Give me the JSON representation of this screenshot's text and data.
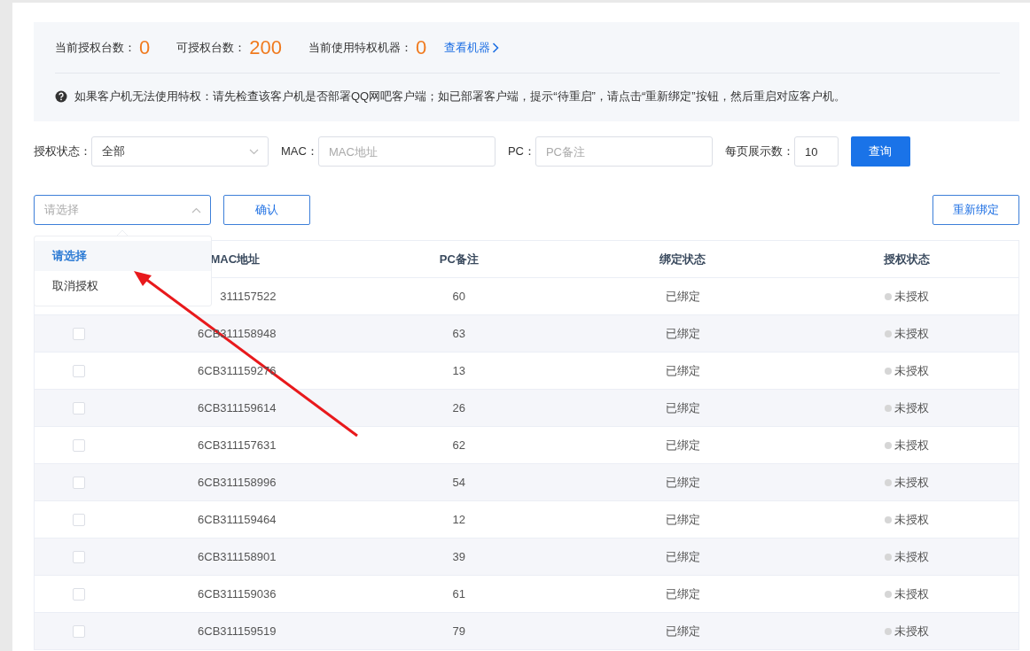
{
  "summary": {
    "stats": [
      {
        "label": "当前授权台数：",
        "value": "0"
      },
      {
        "label": "可授权台数：",
        "value": "200"
      },
      {
        "label": "当前使用特权机器：",
        "value": "0"
      }
    ],
    "link": "查看机器",
    "notice": "如果客户机无法使用特权：请先检查该客户机是否部署QQ网吧客户端；如已部署客户端，提示“待重启”，请点击“重新绑定”按钮，然后重启对应客户机。"
  },
  "filters": {
    "status_label": "授权状态：",
    "status_value": "全部",
    "mac_label": "MAC：",
    "mac_placeholder": "MAC地址",
    "pc_label": "PC：",
    "pc_placeholder": "PC备注",
    "page_size_label": "每页展示数：",
    "page_size_value": "10",
    "query_button": "查询"
  },
  "actions": {
    "select_placeholder": "请选择",
    "expanded": true,
    "options": [
      {
        "label": "请选择",
        "selected": true
      },
      {
        "label": "取消授权",
        "selected": false
      }
    ],
    "confirm_button": "确认",
    "rebind_button": "重新绑定"
  },
  "table": {
    "columns": [
      "MAC地址",
      "PC备注",
      "绑定状态",
      "授权状态"
    ],
    "rows": [
      {
        "mac": "311157522",
        "pc": "60",
        "bind": "已绑定",
        "auth": "未授权"
      },
      {
        "mac": "6CB311158948",
        "pc": "63",
        "bind": "已绑定",
        "auth": "未授权",
        "checked": false
      },
      {
        "mac": "6CB311159276",
        "pc": "13",
        "bind": "已绑定",
        "auth": "未授权",
        "checked": false
      },
      {
        "mac": "6CB311159614",
        "pc": "26",
        "bind": "已绑定",
        "auth": "未授权",
        "checked": false
      },
      {
        "mac": "6CB311157631",
        "pc": "62",
        "bind": "已绑定",
        "auth": "未授权",
        "checked": false
      },
      {
        "mac": "6CB311158996",
        "pc": "54",
        "bind": "已绑定",
        "auth": "未授权",
        "checked": false
      },
      {
        "mac": "6CB311159464",
        "pc": "12",
        "bind": "已绑定",
        "auth": "未授权",
        "checked": false
      },
      {
        "mac": "6CB311158901",
        "pc": "39",
        "bind": "已绑定",
        "auth": "未授权",
        "checked": false
      },
      {
        "mac": "6CB311159036",
        "pc": "61",
        "bind": "已绑定",
        "auth": "未授权",
        "checked": false
      },
      {
        "mac": "6CB311159519",
        "pc": "79",
        "bind": "已绑定",
        "auth": "未授权",
        "checked": false
      }
    ]
  }
}
